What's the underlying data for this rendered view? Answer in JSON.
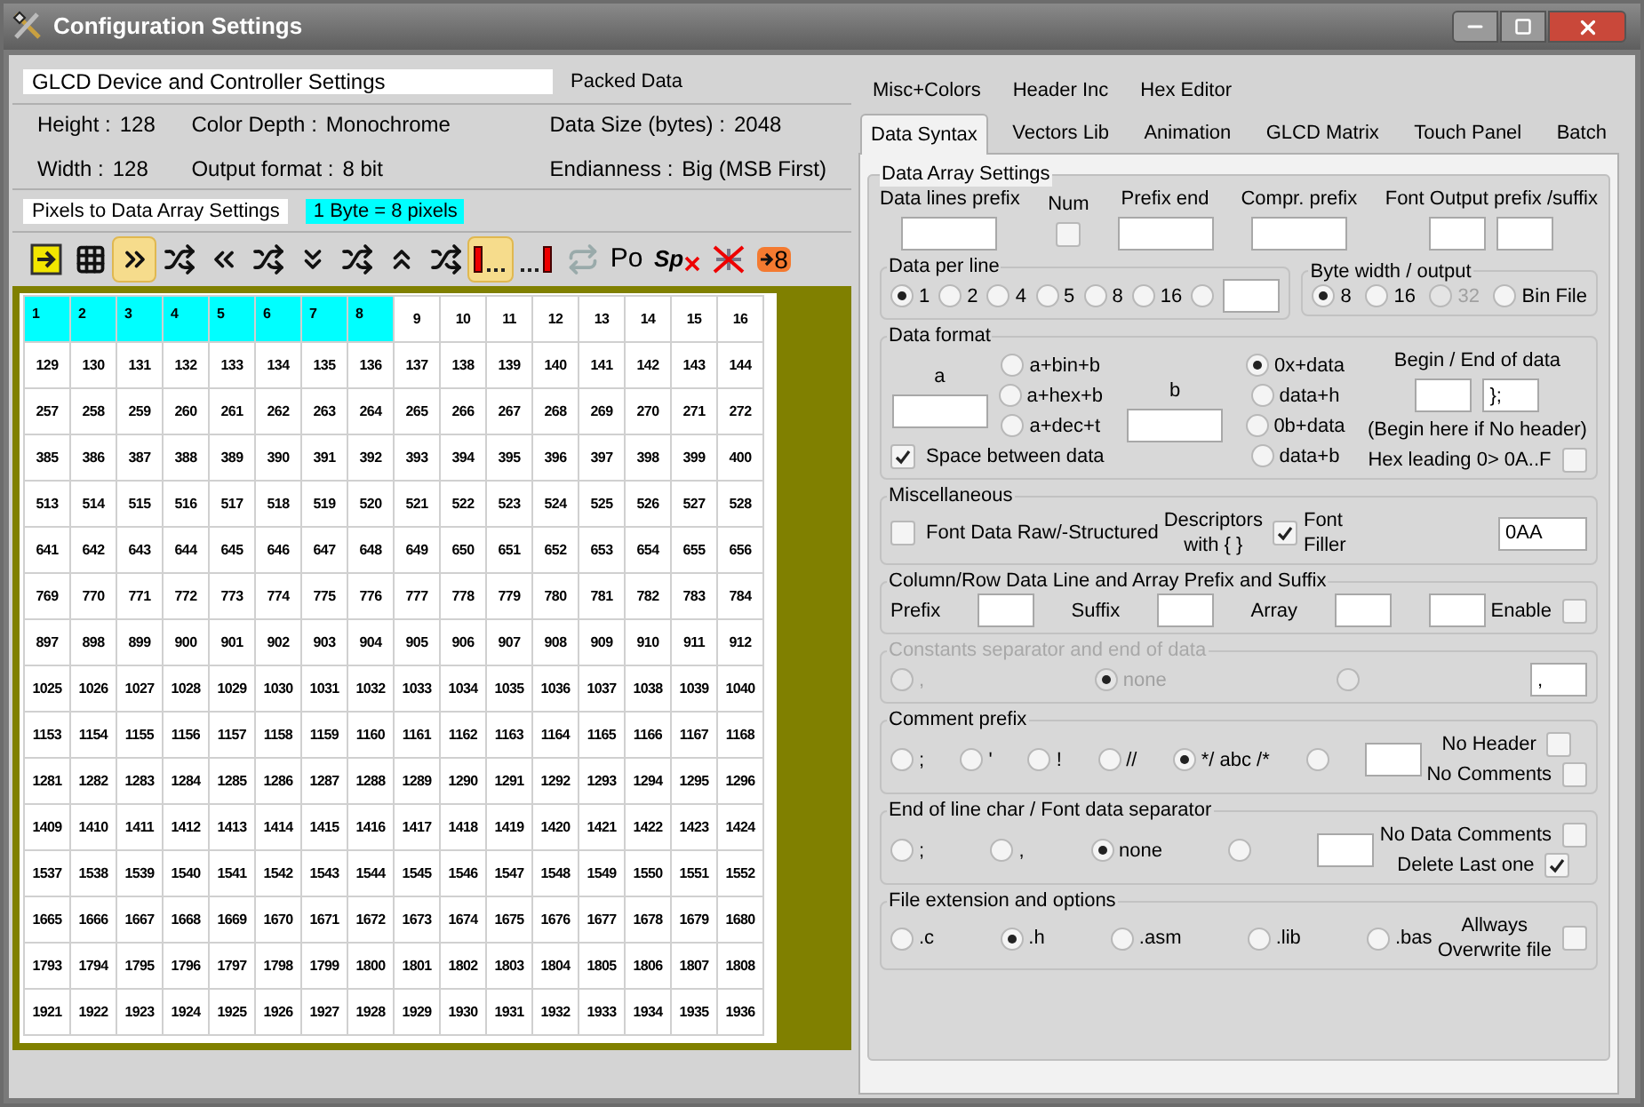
{
  "window": {
    "title": "Configuration Settings"
  },
  "device": {
    "title": "GLCD Device and Controller Settings",
    "packed_label": "Packed Data",
    "info_columns": [
      [
        {
          "label": "Height :",
          "value": "128"
        },
        {
          "label": "Width :",
          "value": "128"
        }
      ],
      [
        {
          "label": "Color Depth :",
          "value": "Monochrome"
        },
        {
          "label": "Output format :",
          "value": "8 bit"
        }
      ],
      [
        {
          "label": "Data Size (bytes) :",
          "value": "2048"
        },
        {
          "label": "Endianness :",
          "value": "Big (MSB First)"
        }
      ]
    ]
  },
  "pixels": {
    "title": "Pixels to Data Array Settings",
    "badge": "1 Byte = 8 pixels"
  },
  "toolbar": [
    {
      "kind": "icon",
      "selected": false
    },
    {
      "kind": "icon",
      "selected": false
    },
    {
      "kind": "icon",
      "selected": true
    },
    {
      "kind": "icon",
      "selected": false
    },
    {
      "kind": "icon",
      "selected": false
    },
    {
      "kind": "icon",
      "selected": false
    },
    {
      "kind": "icon",
      "selected": false
    },
    {
      "kind": "icon",
      "selected": false
    },
    {
      "kind": "icon",
      "selected": false
    },
    {
      "kind": "icon",
      "selected": false
    },
    {
      "kind": "icon",
      "selected": true
    },
    {
      "kind": "icon",
      "selected": false
    },
    {
      "kind": "icon",
      "selected": false
    },
    {
      "kind": "text",
      "text": "Po",
      "selected": false
    },
    {
      "kind": "crossed",
      "text": "Sp",
      "selected": false
    },
    {
      "kind": "icon",
      "selected": false
    },
    {
      "kind": "accent",
      "text": "8",
      "selected": false
    }
  ],
  "grid": {
    "rows": [
      {
        "cells": [
          {
            "text": "1",
            "selected": true
          },
          {
            "text": "2",
            "selected": true
          },
          {
            "text": "3",
            "selected": true
          },
          {
            "text": "4",
            "selected": true
          },
          {
            "text": "5",
            "selected": true
          },
          {
            "text": "6",
            "selected": true
          },
          {
            "text": "7",
            "selected": true
          },
          {
            "text": "8",
            "selected": true
          },
          {
            "text": "9",
            "selected": false
          },
          {
            "text": "10",
            "selected": false
          },
          {
            "text": "11",
            "selected": false
          },
          {
            "text": "12",
            "selected": false
          },
          {
            "text": "13",
            "selected": false
          },
          {
            "text": "14",
            "selected": false
          },
          {
            "text": "15",
            "selected": false
          },
          {
            "text": "16",
            "selected": false
          }
        ]
      },
      {
        "cells": [
          {
            "text": "129",
            "selected": false
          },
          {
            "text": "130",
            "selected": false
          },
          {
            "text": "131",
            "selected": false
          },
          {
            "text": "132",
            "selected": false
          },
          {
            "text": "133",
            "selected": false
          },
          {
            "text": "134",
            "selected": false
          },
          {
            "text": "135",
            "selected": false
          },
          {
            "text": "136",
            "selected": false
          },
          {
            "text": "137",
            "selected": false
          },
          {
            "text": "138",
            "selected": false
          },
          {
            "text": "139",
            "selected": false
          },
          {
            "text": "140",
            "selected": false
          },
          {
            "text": "141",
            "selected": false
          },
          {
            "text": "142",
            "selected": false
          },
          {
            "text": "143",
            "selected": false
          },
          {
            "text": "144",
            "selected": false
          }
        ]
      },
      {
        "cells": [
          {
            "text": "257",
            "selected": false
          },
          {
            "text": "258",
            "selected": false
          },
          {
            "text": "259",
            "selected": false
          },
          {
            "text": "260",
            "selected": false
          },
          {
            "text": "261",
            "selected": false
          },
          {
            "text": "262",
            "selected": false
          },
          {
            "text": "263",
            "selected": false
          },
          {
            "text": "264",
            "selected": false
          },
          {
            "text": "265",
            "selected": false
          },
          {
            "text": "266",
            "selected": false
          },
          {
            "text": "267",
            "selected": false
          },
          {
            "text": "268",
            "selected": false
          },
          {
            "text": "269",
            "selected": false
          },
          {
            "text": "270",
            "selected": false
          },
          {
            "text": "271",
            "selected": false
          },
          {
            "text": "272",
            "selected": false
          }
        ]
      },
      {
        "cells": [
          {
            "text": "385",
            "selected": false
          },
          {
            "text": "386",
            "selected": false
          },
          {
            "text": "387",
            "selected": false
          },
          {
            "text": "388",
            "selected": false
          },
          {
            "text": "389",
            "selected": false
          },
          {
            "text": "390",
            "selected": false
          },
          {
            "text": "391",
            "selected": false
          },
          {
            "text": "392",
            "selected": false
          },
          {
            "text": "393",
            "selected": false
          },
          {
            "text": "394",
            "selected": false
          },
          {
            "text": "395",
            "selected": false
          },
          {
            "text": "396",
            "selected": false
          },
          {
            "text": "397",
            "selected": false
          },
          {
            "text": "398",
            "selected": false
          },
          {
            "text": "399",
            "selected": false
          },
          {
            "text": "400",
            "selected": false
          }
        ]
      },
      {
        "cells": [
          {
            "text": "513",
            "selected": false
          },
          {
            "text": "514",
            "selected": false
          },
          {
            "text": "515",
            "selected": false
          },
          {
            "text": "516",
            "selected": false
          },
          {
            "text": "517",
            "selected": false
          },
          {
            "text": "518",
            "selected": false
          },
          {
            "text": "519",
            "selected": false
          },
          {
            "text": "520",
            "selected": false
          },
          {
            "text": "521",
            "selected": false
          },
          {
            "text": "522",
            "selected": false
          },
          {
            "text": "523",
            "selected": false
          },
          {
            "text": "524",
            "selected": false
          },
          {
            "text": "525",
            "selected": false
          },
          {
            "text": "526",
            "selected": false
          },
          {
            "text": "527",
            "selected": false
          },
          {
            "text": "528",
            "selected": false
          }
        ]
      },
      {
        "cells": [
          {
            "text": "641",
            "selected": false
          },
          {
            "text": "642",
            "selected": false
          },
          {
            "text": "643",
            "selected": false
          },
          {
            "text": "644",
            "selected": false
          },
          {
            "text": "645",
            "selected": false
          },
          {
            "text": "646",
            "selected": false
          },
          {
            "text": "647",
            "selected": false
          },
          {
            "text": "648",
            "selected": false
          },
          {
            "text": "649",
            "selected": false
          },
          {
            "text": "650",
            "selected": false
          },
          {
            "text": "651",
            "selected": false
          },
          {
            "text": "652",
            "selected": false
          },
          {
            "text": "653",
            "selected": false
          },
          {
            "text": "654",
            "selected": false
          },
          {
            "text": "655",
            "selected": false
          },
          {
            "text": "656",
            "selected": false
          }
        ]
      },
      {
        "cells": [
          {
            "text": "769",
            "selected": false
          },
          {
            "text": "770",
            "selected": false
          },
          {
            "text": "771",
            "selected": false
          },
          {
            "text": "772",
            "selected": false
          },
          {
            "text": "773",
            "selected": false
          },
          {
            "text": "774",
            "selected": false
          },
          {
            "text": "775",
            "selected": false
          },
          {
            "text": "776",
            "selected": false
          },
          {
            "text": "777",
            "selected": false
          },
          {
            "text": "778",
            "selected": false
          },
          {
            "text": "779",
            "selected": false
          },
          {
            "text": "780",
            "selected": false
          },
          {
            "text": "781",
            "selected": false
          },
          {
            "text": "782",
            "selected": false
          },
          {
            "text": "783",
            "selected": false
          },
          {
            "text": "784",
            "selected": false
          }
        ]
      },
      {
        "cells": [
          {
            "text": "897",
            "selected": false
          },
          {
            "text": "898",
            "selected": false
          },
          {
            "text": "899",
            "selected": false
          },
          {
            "text": "900",
            "selected": false
          },
          {
            "text": "901",
            "selected": false
          },
          {
            "text": "902",
            "selected": false
          },
          {
            "text": "903",
            "selected": false
          },
          {
            "text": "904",
            "selected": false
          },
          {
            "text": "905",
            "selected": false
          },
          {
            "text": "906",
            "selected": false
          },
          {
            "text": "907",
            "selected": false
          },
          {
            "text": "908",
            "selected": false
          },
          {
            "text": "909",
            "selected": false
          },
          {
            "text": "910",
            "selected": false
          },
          {
            "text": "911",
            "selected": false
          },
          {
            "text": "912",
            "selected": false
          }
        ]
      },
      {
        "cells": [
          {
            "text": "1025",
            "selected": false
          },
          {
            "text": "1026",
            "selected": false
          },
          {
            "text": "1027",
            "selected": false
          },
          {
            "text": "1028",
            "selected": false
          },
          {
            "text": "1029",
            "selected": false
          },
          {
            "text": "1030",
            "selected": false
          },
          {
            "text": "1031",
            "selected": false
          },
          {
            "text": "1032",
            "selected": false
          },
          {
            "text": "1033",
            "selected": false
          },
          {
            "text": "1034",
            "selected": false
          },
          {
            "text": "1035",
            "selected": false
          },
          {
            "text": "1036",
            "selected": false
          },
          {
            "text": "1037",
            "selected": false
          },
          {
            "text": "1038",
            "selected": false
          },
          {
            "text": "1039",
            "selected": false
          },
          {
            "text": "1040",
            "selected": false
          }
        ]
      },
      {
        "cells": [
          {
            "text": "1153",
            "selected": false
          },
          {
            "text": "1154",
            "selected": false
          },
          {
            "text": "1155",
            "selected": false
          },
          {
            "text": "1156",
            "selected": false
          },
          {
            "text": "1157",
            "selected": false
          },
          {
            "text": "1158",
            "selected": false
          },
          {
            "text": "1159",
            "selected": false
          },
          {
            "text": "1160",
            "selected": false
          },
          {
            "text": "1161",
            "selected": false
          },
          {
            "text": "1162",
            "selected": false
          },
          {
            "text": "1163",
            "selected": false
          },
          {
            "text": "1164",
            "selected": false
          },
          {
            "text": "1165",
            "selected": false
          },
          {
            "text": "1166",
            "selected": false
          },
          {
            "text": "1167",
            "selected": false
          },
          {
            "text": "1168",
            "selected": false
          }
        ]
      },
      {
        "cells": [
          {
            "text": "1281",
            "selected": false
          },
          {
            "text": "1282",
            "selected": false
          },
          {
            "text": "1283",
            "selected": false
          },
          {
            "text": "1284",
            "selected": false
          },
          {
            "text": "1285",
            "selected": false
          },
          {
            "text": "1286",
            "selected": false
          },
          {
            "text": "1287",
            "selected": false
          },
          {
            "text": "1288",
            "selected": false
          },
          {
            "text": "1289",
            "selected": false
          },
          {
            "text": "1290",
            "selected": false
          },
          {
            "text": "1291",
            "selected": false
          },
          {
            "text": "1292",
            "selected": false
          },
          {
            "text": "1293",
            "selected": false
          },
          {
            "text": "1294",
            "selected": false
          },
          {
            "text": "1295",
            "selected": false
          },
          {
            "text": "1296",
            "selected": false
          }
        ]
      },
      {
        "cells": [
          {
            "text": "1409",
            "selected": false
          },
          {
            "text": "1410",
            "selected": false
          },
          {
            "text": "1411",
            "selected": false
          },
          {
            "text": "1412",
            "selected": false
          },
          {
            "text": "1413",
            "selected": false
          },
          {
            "text": "1414",
            "selected": false
          },
          {
            "text": "1415",
            "selected": false
          },
          {
            "text": "1416",
            "selected": false
          },
          {
            "text": "1417",
            "selected": false
          },
          {
            "text": "1418",
            "selected": false
          },
          {
            "text": "1419",
            "selected": false
          },
          {
            "text": "1420",
            "selected": false
          },
          {
            "text": "1421",
            "selected": false
          },
          {
            "text": "1422",
            "selected": false
          },
          {
            "text": "1423",
            "selected": false
          },
          {
            "text": "1424",
            "selected": false
          }
        ]
      },
      {
        "cells": [
          {
            "text": "1537",
            "selected": false
          },
          {
            "text": "1538",
            "selected": false
          },
          {
            "text": "1539",
            "selected": false
          },
          {
            "text": "1540",
            "selected": false
          },
          {
            "text": "1541",
            "selected": false
          },
          {
            "text": "1542",
            "selected": false
          },
          {
            "text": "1543",
            "selected": false
          },
          {
            "text": "1544",
            "selected": false
          },
          {
            "text": "1545",
            "selected": false
          },
          {
            "text": "1546",
            "selected": false
          },
          {
            "text": "1547",
            "selected": false
          },
          {
            "text": "1548",
            "selected": false
          },
          {
            "text": "1549",
            "selected": false
          },
          {
            "text": "1550",
            "selected": false
          },
          {
            "text": "1551",
            "selected": false
          },
          {
            "text": "1552",
            "selected": false
          }
        ]
      },
      {
        "cells": [
          {
            "text": "1665",
            "selected": false
          },
          {
            "text": "1666",
            "selected": false
          },
          {
            "text": "1667",
            "selected": false
          },
          {
            "text": "1668",
            "selected": false
          },
          {
            "text": "1669",
            "selected": false
          },
          {
            "text": "1670",
            "selected": false
          },
          {
            "text": "1671",
            "selected": false
          },
          {
            "text": "1672",
            "selected": false
          },
          {
            "text": "1673",
            "selected": false
          },
          {
            "text": "1674",
            "selected": false
          },
          {
            "text": "1675",
            "selected": false
          },
          {
            "text": "1676",
            "selected": false
          },
          {
            "text": "1677",
            "selected": false
          },
          {
            "text": "1678",
            "selected": false
          },
          {
            "text": "1679",
            "selected": false
          },
          {
            "text": "1680",
            "selected": false
          }
        ]
      },
      {
        "cells": [
          {
            "text": "1793",
            "selected": false
          },
          {
            "text": "1794",
            "selected": false
          },
          {
            "text": "1795",
            "selected": false
          },
          {
            "text": "1796",
            "selected": false
          },
          {
            "text": "1797",
            "selected": false
          },
          {
            "text": "1798",
            "selected": false
          },
          {
            "text": "1799",
            "selected": false
          },
          {
            "text": "1800",
            "selected": false
          },
          {
            "text": "1801",
            "selected": false
          },
          {
            "text": "1802",
            "selected": false
          },
          {
            "text": "1803",
            "selected": false
          },
          {
            "text": "1804",
            "selected": false
          },
          {
            "text": "1805",
            "selected": false
          },
          {
            "text": "1806",
            "selected": false
          },
          {
            "text": "1807",
            "selected": false
          },
          {
            "text": "1808",
            "selected": false
          }
        ]
      },
      {
        "cells": [
          {
            "text": "1921",
            "selected": false
          },
          {
            "text": "1922",
            "selected": false
          },
          {
            "text": "1923",
            "selected": false
          },
          {
            "text": "1924",
            "selected": false
          },
          {
            "text": "1925",
            "selected": false
          },
          {
            "text": "1926",
            "selected": false
          },
          {
            "text": "1927",
            "selected": false
          },
          {
            "text": "1928",
            "selected": false
          },
          {
            "text": "1929",
            "selected": false
          },
          {
            "text": "1930",
            "selected": false
          },
          {
            "text": "1931",
            "selected": false
          },
          {
            "text": "1932",
            "selected": false
          },
          {
            "text": "1933",
            "selected": false
          },
          {
            "text": "1934",
            "selected": false
          },
          {
            "text": "1935",
            "selected": false
          },
          {
            "text": "1936",
            "selected": false
          }
        ]
      }
    ]
  },
  "tabs_row1": [
    {
      "label": "Misc+Colors",
      "selected": false
    },
    {
      "label": "Header Inc",
      "selected": false
    },
    {
      "label": "Hex Editor",
      "selected": false
    }
  ],
  "tabs_row2": [
    {
      "label": "Data Syntax",
      "selected": true
    },
    {
      "label": "Vectors Lib",
      "selected": false
    },
    {
      "label": "Animation",
      "selected": false
    },
    {
      "label": "GLCD Matrix",
      "selected": false
    },
    {
      "label": "Touch Panel",
      "selected": false
    },
    {
      "label": "Batch",
      "selected": false
    }
  ],
  "panel": {
    "title": "Data Array Settings",
    "items": [
      {
        "kind": "row",
        "items": [
          {
            "kind": "col",
            "items": [
              {
                "kind": "text",
                "text": "Data lines prefix"
              },
              {
                "kind": "field"
              }
            ]
          },
          {
            "kind": "col",
            "items": [
              {
                "kind": "text",
                "text": "Num"
              },
              {
                "kind": "checkbox",
                "checked": false
              }
            ]
          },
          {
            "kind": "col",
            "items": [
              {
                "kind": "text",
                "text": "Prefix end"
              },
              {
                "kind": "field"
              }
            ]
          },
          {
            "kind": "col",
            "items": [
              {
                "kind": "text",
                "text": "Compr. prefix"
              },
              {
                "kind": "field"
              }
            ]
          },
          {
            "kind": "col",
            "items": [
              {
                "kind": "text",
                "text": "Font Output prefix /suffix"
              },
              {
                "kind": "row",
                "items": [
                  {
                    "kind": "field"
                  },
                  {
                    "kind": "field"
                  }
                ]
              }
            ]
          }
        ]
      },
      {
        "kind": "row",
        "items": [
          {
            "kind": "group",
            "title": "Data per line",
            "disabled": false,
            "items": [
              {
                "kind": "radio",
                "label": "1",
                "selected": true
              },
              {
                "kind": "radio",
                "label": "2",
                "selected": false
              },
              {
                "kind": "radio",
                "label": "4",
                "selected": false
              },
              {
                "kind": "radio",
                "label": "5",
                "selected": false
              },
              {
                "kind": "radio",
                "label": "8",
                "selected": false
              },
              {
                "kind": "radio",
                "label": "16",
                "selected": false
              },
              {
                "kind": "radio",
                "selected": false
              },
              {
                "kind": "field"
              }
            ]
          },
          {
            "kind": "group",
            "title": "Byte width / output",
            "disabled": false,
            "items": [
              {
                "kind": "radio",
                "label": "8",
                "selected": true,
                "disabled": false
              },
              {
                "kind": "radio",
                "label": "16",
                "selected": false,
                "disabled": false
              },
              {
                "kind": "radio",
                "label": "32",
                "selected": false,
                "disabled": true
              },
              {
                "kind": "radio",
                "label": "Bin File",
                "selected": false,
                "disabled": false
              }
            ]
          }
        ]
      },
      {
        "kind": "group",
        "title": "Data format",
        "disabled": false,
        "items": [
          {
            "kind": "col",
            "items": [
              {
                "kind": "row",
                "items": [
                  {
                    "kind": "col",
                    "items": [
                      {
                        "kind": "text",
                        "text": "a"
                      },
                      {
                        "kind": "field"
                      }
                    ]
                  },
                  {
                    "kind": "col",
                    "items": [
                      {
                        "kind": "radio",
                        "label": "a+bin+b",
                        "selected": false
                      },
                      {
                        "kind": "radio",
                        "label": "a+hex+b",
                        "selected": false
                      },
                      {
                        "kind": "radio",
                        "label": "a+dec+t",
                        "selected": false
                      }
                    ]
                  }
                ]
              },
              {
                "kind": "checkbox",
                "label": "Space between data",
                "checked": true
              }
            ]
          },
          {
            "kind": "col",
            "items": [
              {
                "kind": "text",
                "text": "b"
              },
              {
                "kind": "field"
              }
            ]
          },
          {
            "kind": "col",
            "items": [
              {
                "kind": "radio",
                "label": "0x+data",
                "selected": true
              },
              {
                "kind": "radio",
                "label": "data+h",
                "selected": false
              },
              {
                "kind": "radio",
                "label": "0b+data",
                "selected": false
              },
              {
                "kind": "radio",
                "label": "data+b",
                "selected": false
              }
            ]
          },
          {
            "kind": "col",
            "items": [
              {
                "kind": "text",
                "text": "Begin / End of data"
              },
              {
                "kind": "row",
                "items": [
                  {
                    "kind": "field"
                  },
                  {
                    "kind": "field",
                    "value": "};"
                  }
                ]
              },
              {
                "kind": "text",
                "text": "(Begin here if No header)"
              },
              {
                "kind": "label-checkbox",
                "label": "Hex leading 0> 0A..F",
                "checked": false
              }
            ]
          }
        ]
      },
      {
        "kind": "group",
        "title": "Miscellaneous",
        "disabled": false,
        "items": [
          {
            "kind": "checkbox",
            "label": "Font Data Raw/-Structured",
            "checked": false
          },
          {
            "kind": "label-checkbox",
            "label": "Descriptors\nwith { }",
            "checked": true
          },
          {
            "kind": "row",
            "items": [
              {
                "kind": "text",
                "text": "Font\nFiller"
              },
              {
                "kind": "field",
                "value": "0AA"
              }
            ]
          }
        ]
      },
      {
        "kind": "group",
        "title": "Column/Row Data Line and Array Prefix and Suffix",
        "disabled": false,
        "items": [
          {
            "kind": "row",
            "items": [
              {
                "kind": "text",
                "text": "Prefix"
              },
              {
                "kind": "field"
              },
              {
                "kind": "text",
                "text": "Suffix"
              },
              {
                "kind": "field"
              },
              {
                "kind": "text",
                "text": "Array"
              },
              {
                "kind": "field"
              },
              {
                "kind": "field"
              }
            ]
          },
          {
            "kind": "label-checkbox",
            "label": "Enable",
            "checked": false
          }
        ]
      },
      {
        "kind": "group",
        "title": "Constants separator and end of data",
        "disabled": true,
        "items": [
          {
            "kind": "row",
            "items": [
              {
                "kind": "radio",
                "label": ",",
                "selected": false
              },
              {
                "kind": "radio",
                "label": "none",
                "selected": true
              },
              {
                "kind": "radio",
                "selected": false
              },
              {
                "kind": "field",
                "value": ","
              }
            ]
          }
        ]
      },
      {
        "kind": "group",
        "title": "Comment prefix",
        "disabled": false,
        "items": [
          {
            "kind": "row",
            "items": [
              {
                "kind": "radio",
                "label": ";",
                "selected": false
              },
              {
                "kind": "radio",
                "label": "'",
                "selected": false
              },
              {
                "kind": "radio",
                "label": "!",
                "selected": false
              },
              {
                "kind": "radio",
                "label": "//",
                "selected": false
              },
              {
                "kind": "radio",
                "label": "*/ abc /*",
                "selected": true
              },
              {
                "kind": "radio",
                "selected": false
              },
              {
                "kind": "field"
              }
            ]
          },
          {
            "kind": "col",
            "items": [
              {
                "kind": "label-checkbox",
                "label": "No Header",
                "checked": false
              },
              {
                "kind": "label-checkbox",
                "label": "No Comments",
                "checked": false
              }
            ]
          }
        ]
      },
      {
        "kind": "group",
        "title": "End of line char / Font data separator",
        "disabled": false,
        "items": [
          {
            "kind": "row",
            "items": [
              {
                "kind": "radio",
                "label": ";",
                "selected": false
              },
              {
                "kind": "radio",
                "label": ",",
                "selected": false
              },
              {
                "kind": "radio",
                "label": "none",
                "selected": true
              },
              {
                "kind": "radio",
                "selected": false
              },
              {
                "kind": "field"
              }
            ]
          },
          {
            "kind": "col",
            "items": [
              {
                "kind": "label-checkbox",
                "label": "No Data Comments",
                "checked": false
              },
              {
                "kind": "label-checkbox",
                "label": "Delete Last one",
                "checked": true
              }
            ]
          }
        ]
      },
      {
        "kind": "group",
        "title": "File extension and options",
        "disabled": false,
        "items": [
          {
            "kind": "row",
            "items": [
              {
                "kind": "radio",
                "label": ".c",
                "selected": false
              },
              {
                "kind": "radio",
                "label": ".h",
                "selected": true
              },
              {
                "kind": "radio",
                "label": ".asm",
                "selected": false
              },
              {
                "kind": "radio",
                "label": ".lib",
                "selected": false
              },
              {
                "kind": "radio",
                "label": ".bas",
                "selected": false
              }
            ]
          },
          {
            "kind": "label-checkbox",
            "label": "Allways\nOverwrite file",
            "checked": false
          }
        ]
      }
    ]
  }
}
